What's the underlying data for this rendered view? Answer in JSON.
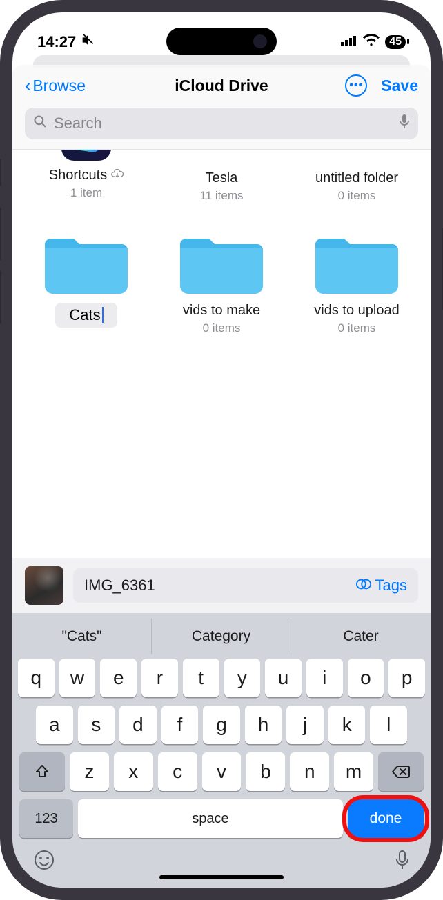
{
  "status": {
    "time": "14:27",
    "bell_muted": true,
    "battery": "45"
  },
  "nav": {
    "back_label": "Browse",
    "title": "iCloud Drive",
    "save_label": "Save"
  },
  "search": {
    "placeholder": "Search"
  },
  "folders_row1": [
    {
      "name": "Shortcuts",
      "sub": "1 item",
      "type": "app",
      "cloud": true
    },
    {
      "name": "Tesla",
      "sub": "11 items",
      "type": "folder"
    },
    {
      "name": "untitled folder",
      "sub": "0 items",
      "type": "folder"
    }
  ],
  "folders_row2": [
    {
      "name": "Cats",
      "sub": "",
      "type": "folder",
      "editing": true
    },
    {
      "name": "vids to make",
      "sub": "0 items",
      "type": "folder"
    },
    {
      "name": "vids to upload",
      "sub": "0 items",
      "type": "folder"
    }
  ],
  "file": {
    "name": "IMG_6361",
    "tags_label": "Tags"
  },
  "keyboard": {
    "suggestions": [
      "\"Cats\"",
      "Category",
      "Cater"
    ],
    "row1": [
      "q",
      "w",
      "e",
      "r",
      "t",
      "y",
      "u",
      "i",
      "o",
      "p"
    ],
    "row2": [
      "a",
      "s",
      "d",
      "f",
      "g",
      "h",
      "j",
      "k",
      "l"
    ],
    "row3": [
      "z",
      "x",
      "c",
      "v",
      "b",
      "n",
      "m"
    ],
    "num_label": "123",
    "space_label": "space",
    "done_label": "done"
  }
}
